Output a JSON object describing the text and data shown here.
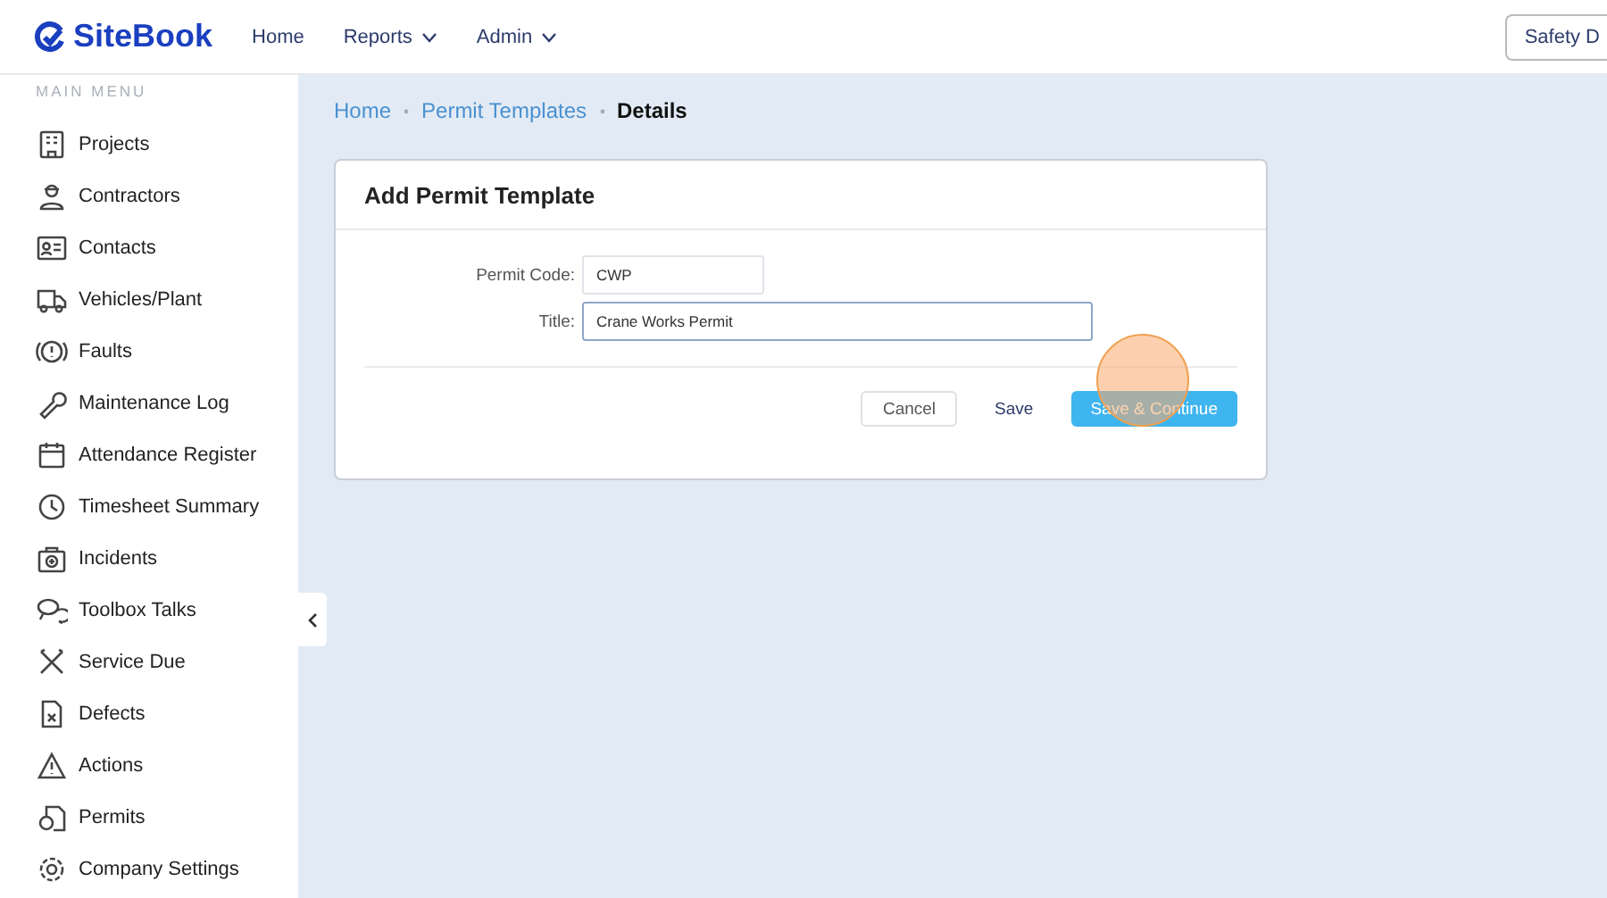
{
  "header": {
    "brand": "SiteBook",
    "nav": [
      {
        "label": "Home",
        "dropdown": false
      },
      {
        "label": "Reports",
        "dropdown": true
      },
      {
        "label": "Admin",
        "dropdown": true
      }
    ],
    "right_button": "Safety D"
  },
  "sidebar": {
    "heading": "MAIN MENU",
    "items": [
      {
        "label": "Projects"
      },
      {
        "label": "Contractors"
      },
      {
        "label": "Contacts"
      },
      {
        "label": "Vehicles/Plant"
      },
      {
        "label": "Faults"
      },
      {
        "label": "Maintenance Log"
      },
      {
        "label": "Attendance Register"
      },
      {
        "label": "Timesheet Summary"
      },
      {
        "label": "Incidents"
      },
      {
        "label": "Toolbox Talks"
      },
      {
        "label": "Service Due"
      },
      {
        "label": "Defects"
      },
      {
        "label": "Actions"
      },
      {
        "label": "Permits"
      },
      {
        "label": "Company Settings"
      }
    ]
  },
  "breadcrumb": [
    {
      "label": "Home",
      "current": false
    },
    {
      "label": "Permit Templates",
      "current": false
    },
    {
      "label": "Details",
      "current": true
    }
  ],
  "card": {
    "title": "Add Permit Template",
    "fields": [
      {
        "label": "Permit Code:",
        "value": "CWP",
        "focused": false
      },
      {
        "label": "Title:",
        "value": "Crane Works Permit",
        "focused": true
      }
    ],
    "buttons": [
      {
        "label": "Cancel",
        "kind": "outline"
      },
      {
        "label": "Save",
        "kind": "text"
      },
      {
        "label": "Save & Continue",
        "kind": "primary"
      }
    ]
  }
}
